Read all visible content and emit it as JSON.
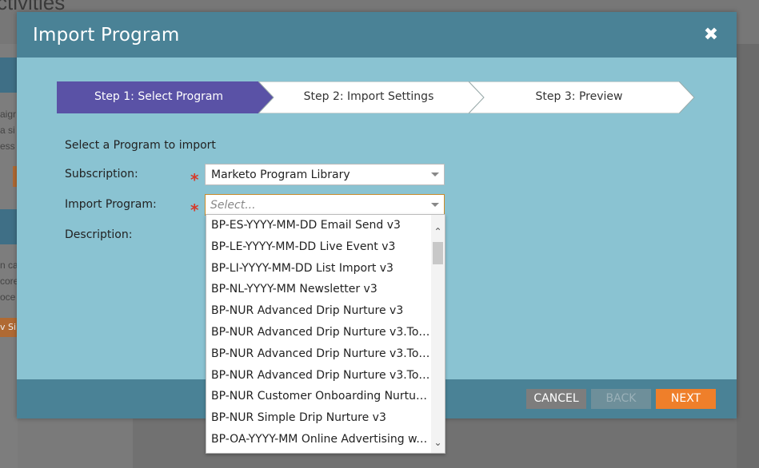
{
  "background": {
    "title_fragment": "ctivities",
    "text_fragments": [
      "aigr",
      "a si",
      "ess",
      "n ca",
      "core",
      "oce",
      "v Si"
    ]
  },
  "modal": {
    "title": "Import Program",
    "close_icon": "close-icon",
    "steps": [
      {
        "label": "Step 1: Select Program",
        "active": true
      },
      {
        "label": "Step 2: Import Settings",
        "active": false
      },
      {
        "label": "Step 3: Preview",
        "active": false
      }
    ],
    "form": {
      "intro": "Select a Program to import",
      "subscription_label": "Subscription:",
      "subscription_value": "Marketo Program Library",
      "import_program_label": "Import Program:",
      "import_program_placeholder": "Select...",
      "description_label": "Description:",
      "required_mark": "*"
    },
    "footer": {
      "cancel": "CANCEL",
      "back": "BACK",
      "next": "NEXT"
    }
  },
  "dropdown": {
    "options": [
      "BP-ES-YYYY-MM-DD Email Send v3",
      "BP-LE-YYYY-MM-DD Live Event v3",
      "BP-LI-YYYY-MM-DD List Import v3",
      "BP-NL-YYYY-MM Newsletter v3",
      "BP-NUR Advanced Drip Nurture v3",
      "BP-NUR Advanced Drip Nurture v3.Topi...",
      "BP-NUR Advanced Drip Nurture v3.Topi...",
      "BP-NUR Advanced Drip Nurture v3.Topi...",
      "BP-NUR Customer Onboarding Nurture...",
      "BP-NUR Simple Drip Nurture v3",
      "BP-OA-YYYY-MM Online Advertising w. ..."
    ]
  },
  "colors": {
    "header": "#4a8296",
    "body": "#8ac3d2",
    "step_active": "#5a52a6",
    "next_button": "#ef7f2a",
    "required": "#d63a2a"
  }
}
